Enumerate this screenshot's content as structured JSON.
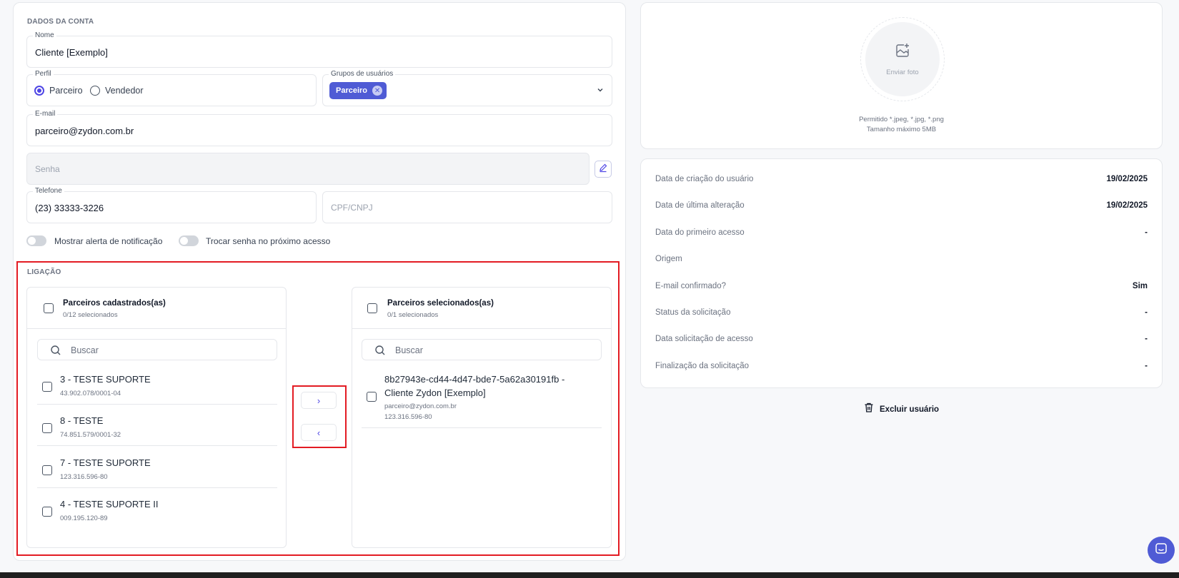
{
  "account": {
    "section_title": "DADOS DA CONTA",
    "name_label": "Nome",
    "name_value": "Cliente [Exemplo]",
    "profile_label": "Perfil",
    "profile_options": [
      "Parceiro",
      "Vendedor"
    ],
    "groups_label": "Grupos de usuários",
    "groups_chip": "Parceiro",
    "email_label": "E-mail",
    "email_value": "parceiro@zydon.com.br",
    "password_placeholder": "Senha",
    "phone_label": "Telefone",
    "phone_value": "(23) 33333-3226",
    "cpf_placeholder": "CPF/CNPJ",
    "toggle_notification": "Mostrar alerta de notificação",
    "toggle_change_password": "Trocar senha no próximo acesso"
  },
  "link": {
    "section_title": "LIGAÇÃO",
    "left": {
      "title": "Parceiros cadastrados(as)",
      "subtitle": "0/12 selecionados",
      "search_placeholder": "Buscar",
      "items": [
        {
          "name": "3 - TESTE SUPORTE",
          "doc": "43.902.078/0001-04"
        },
        {
          "name": "8 - TESTE",
          "doc": "74.851.579/0001-32"
        },
        {
          "name": "7 - TESTE SUPORTE",
          "doc": "123.316.596-80"
        },
        {
          "name": "4 - TESTE SUPORTE II",
          "doc": "009.195.120-89"
        }
      ]
    },
    "right": {
      "title": "Parceiros selecionados(as)",
      "subtitle": "0/1 selecionados",
      "search_placeholder": "Buscar",
      "items": [
        {
          "name_line1": "8b27943e-cd44-4d47-bde7-5a62a30191fb -",
          "name_line2": "Cliente Zydon [Exemplo]",
          "email": "parceiro@zydon.com.br",
          "doc": "123.316.596-80"
        }
      ]
    },
    "move_right": "›",
    "move_left": "‹"
  },
  "photo": {
    "upload_label": "Enviar foto",
    "allowed": "Permitido *.jpeg, *.jpg, *.png",
    "max_size": "Tamanho máximo 5MB"
  },
  "info": [
    {
      "key": "Data de criação do usuário",
      "value": "19/02/2025"
    },
    {
      "key": "Data de última alteração",
      "value": "19/02/2025"
    },
    {
      "key": "Data do primeiro acesso",
      "value": "-"
    },
    {
      "key": "Origem",
      "value": ""
    },
    {
      "key": "E-mail confirmado?",
      "value": "Sim"
    },
    {
      "key": "Status da solicitação",
      "value": "-"
    },
    {
      "key": "Data solicitação de acesso",
      "value": "-"
    },
    {
      "key": "Finalização da solicitação",
      "value": "-"
    }
  ],
  "delete_label": "Excluir usuário",
  "colors": {
    "accent": "#4f5bd5",
    "highlight": "#e31b23"
  },
  "icons": [
    "add-photo-icon",
    "edit-icon",
    "search-icon",
    "trash-icon",
    "chat-icon",
    "chevron-down-icon"
  ]
}
